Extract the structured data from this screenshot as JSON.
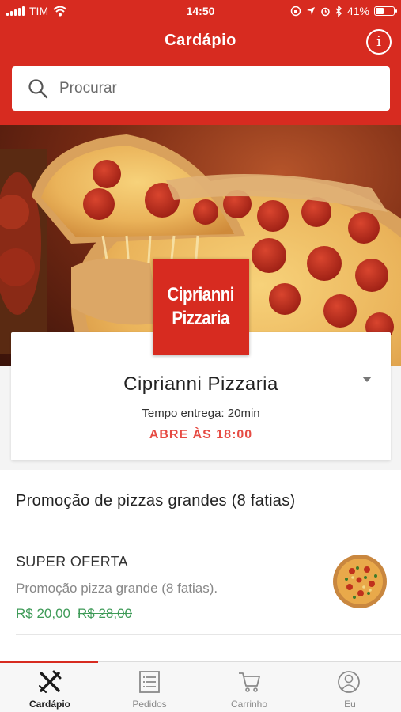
{
  "status_bar": {
    "carrier": "TIM",
    "time": "14:50",
    "battery": "41%",
    "battery_level": 0.41
  },
  "header": {
    "title": "Cardápio",
    "info_label": "i"
  },
  "search": {
    "placeholder": "Procurar"
  },
  "restaurant": {
    "logo_line1": "Ciprianni",
    "logo_line2": "Pizzaria",
    "name": "Ciprianni Pizzaria",
    "delivery_time": "Tempo entrega: 20min",
    "status": "ABRE ÀS 18:00"
  },
  "menu": {
    "section_title": "Promoção de pizzas grandes (8 fatias)",
    "items": [
      {
        "name": "SUPER OFERTA",
        "description": "Promoção pizza grande (8 fatias).",
        "price": "R$ 20,00",
        "old_price": "R$ 28,00"
      }
    ]
  },
  "tabs": [
    {
      "label": "Cardápio",
      "icon": "fork-knife-icon",
      "active": true
    },
    {
      "label": "Pedidos",
      "icon": "list-icon",
      "active": false
    },
    {
      "label": "Carrinho",
      "icon": "cart-icon",
      "active": false
    },
    {
      "label": "Eu",
      "icon": "user-icon",
      "active": false
    }
  ],
  "colors": {
    "brand": "#d72b20",
    "price": "#3f9b58",
    "status": "#e64b43"
  }
}
